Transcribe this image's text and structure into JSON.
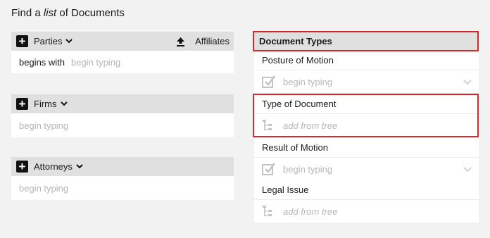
{
  "title": {
    "prefix": "Find a ",
    "emph": "list",
    "suffix": " of Documents"
  },
  "left_panels": [
    {
      "name": "Parties",
      "body_label": "begins with",
      "placeholder": "begin typing",
      "action": "Affiliates"
    },
    {
      "name": "Firms",
      "placeholder": "begin typing"
    },
    {
      "name": "Attorneys",
      "placeholder": "begin typing"
    }
  ],
  "document_types": {
    "header": "Document Types",
    "sections": [
      {
        "label": "Posture of Motion",
        "placeholder": "begin typing",
        "kind": "select"
      },
      {
        "label": "Type of Document",
        "placeholder": "add from tree",
        "kind": "tree"
      },
      {
        "label": "Result of Motion",
        "placeholder": "begin typing",
        "kind": "select"
      },
      {
        "label": "Legal Issue",
        "placeholder": "add from tree",
        "kind": "tree"
      }
    ]
  },
  "colors": {
    "highlight": "#d62828",
    "header_bg": "#e0e0e0"
  }
}
